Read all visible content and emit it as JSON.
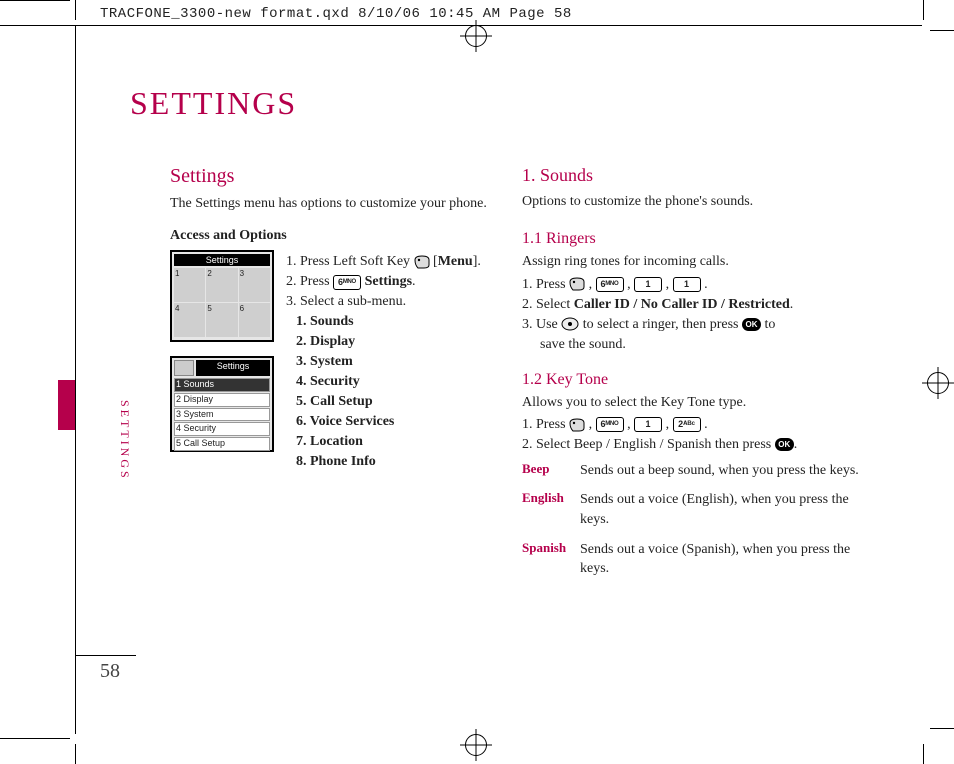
{
  "prepress_header": "TRACFONE_3300-new format.qxd  8/10/06  10:45 AM  Page 58",
  "page_title": "SETTINGS",
  "side_label": "SETTINGS",
  "page_number": "58",
  "left": {
    "heading": "Settings",
    "intro": "The Settings menu has options to customize your phone.",
    "access_heading": "Access and Options",
    "thumb1_title": "Settings",
    "thumb1_grid": [
      "1",
      "2",
      "3",
      "4",
      "5",
      "6"
    ],
    "thumb2_title": "Settings",
    "thumb2_items": [
      "1 Sounds",
      "2 Display",
      "3 System",
      "4 Security",
      "5 Call Setup"
    ],
    "step1_pre": "1.   Press Left Soft Key ",
    "step1_menu": "Menu",
    "step2_pre": "2.  Press ",
    "step2_key": "6ᴹᴺᴼ",
    "step2_label": "Settings",
    "step3": "3.  Select a sub-menu.",
    "submenu": [
      "1. Sounds",
      "2. Display",
      "3. System",
      "4. Security",
      "5. Call Setup",
      "6. Voice Services",
      "7. Location",
      "8. Phone Info"
    ]
  },
  "right": {
    "sounds_heading": "1. Sounds",
    "sounds_intro": "Options to customize the phone's sounds.",
    "ringers_heading": "1.1 Ringers",
    "ringers_intro": "Assign ring tones for incoming calls.",
    "ringers_step1_pre": "1. Press ",
    "ringers_keys": [
      "6ᴹᴺᴼ",
      "1",
      "1"
    ],
    "ringers_step2_pre": "2. Select ",
    "ringers_step2_bold": "Caller ID / No Caller ID / Restricted",
    "ringers_step3a": "3. Use ",
    "ringers_step3b": " to select a ringer, then press ",
    "ringers_step3c": " to",
    "ringers_step3d": "save the sound.",
    "keytone_heading": "1.2 Key Tone",
    "keytone_intro": "Allows you to select the Key Tone type.",
    "keytone_step1_pre": "1. Press ",
    "keytone_keys": [
      "6ᴹᴺᴼ",
      "1",
      "2ᴬᴮᶜ"
    ],
    "keytone_step2": "2. Select Beep / English / Spanish then press ",
    "keytone_table": [
      {
        "label": "Beep",
        "desc": "Sends out a beep sound, when you press the keys."
      },
      {
        "label": "English",
        "desc": "Sends out a voice (English), when you press the keys."
      },
      {
        "label": "Spanish",
        "desc": "Sends out a voice (Spanish), when you press the keys."
      }
    ],
    "ok_label": "OK"
  }
}
